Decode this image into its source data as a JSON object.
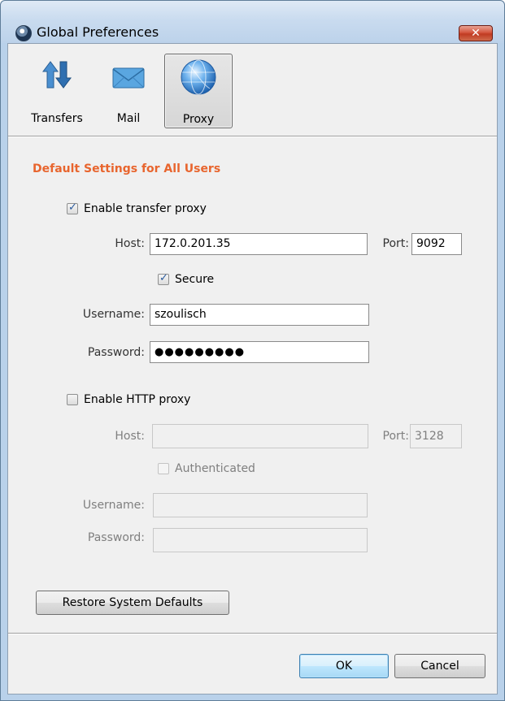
{
  "window": {
    "title": "Global Preferences",
    "close_glyph": "✕"
  },
  "toolbar": {
    "items": [
      {
        "label": "Transfers",
        "icon": "transfer-arrows-icon",
        "active": false
      },
      {
        "label": "Mail",
        "icon": "envelope-icon",
        "active": false
      },
      {
        "label": "Proxy",
        "icon": "globe-icon",
        "active": true
      }
    ]
  },
  "section": {
    "title": "Default Settings for All Users"
  },
  "transfer_proxy": {
    "enable_label": "Enable transfer proxy",
    "enabled": true,
    "host_label": "Host:",
    "host_value": "172.0.201.35",
    "port_label": "Port:",
    "port_value": "9092",
    "secure_label": "Secure",
    "secure": true,
    "username_label": "Username:",
    "username_value": "szoulisch",
    "password_label": "Password:",
    "password_dots": "●●●●●●●●●"
  },
  "http_proxy": {
    "enable_label": "Enable HTTP proxy",
    "enabled": false,
    "host_label": "Host:",
    "host_value": "",
    "port_label": "Port:",
    "port_value": "3128",
    "authenticated_label": "Authenticated",
    "authenticated": false,
    "username_label": "Username:",
    "username_value": "",
    "password_label": "Password:",
    "password_value": ""
  },
  "buttons": {
    "restore": "Restore System Defaults",
    "ok": "OK",
    "cancel": "Cancel"
  },
  "colors": {
    "section_title": "#e8652e",
    "titlebar": "#c9dbef",
    "close": "#c03b22"
  }
}
